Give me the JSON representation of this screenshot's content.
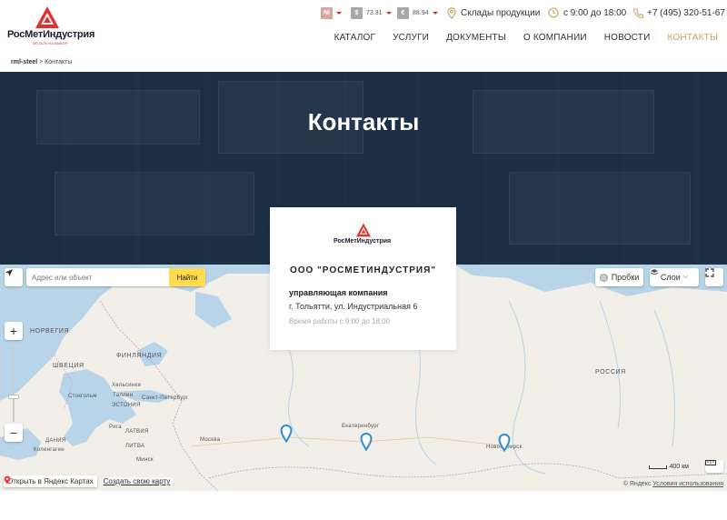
{
  "header": {
    "logo_text": "РосМетИндустрия",
    "logo_sub": "МЕТАЛЛ НА ВЫБОР",
    "currencies": [
      {
        "code": "Ni",
        "value": ""
      },
      {
        "code": "$",
        "value": "73.31"
      },
      {
        "code": "€",
        "value": "88.94"
      }
    ],
    "warehouses_label": "Склады продукции",
    "hours_label": "с 9:00 до 18:00",
    "phone": "+7 (495) 320-51-67",
    "nav": [
      "КАТАЛОГ",
      "УСЛУГИ",
      "ДОКУМЕНТЫ",
      "О КОМПАНИИ",
      "НОВОСТИ",
      "КОНТАКТЫ"
    ],
    "active_nav": "КОНТАКТЫ"
  },
  "breadcrumb": {
    "home": "rml-steel",
    "separator": " > ",
    "current": "Контакты"
  },
  "hero": {
    "title": "Контакты"
  },
  "card": {
    "logo_text": "РосМетИндустрия",
    "company": "ООО \"РОСМЕТИНДУСТРИЯ\"",
    "role": "управляющая компания",
    "address": "г. Тольятти, ул. Индустриальная 6",
    "hours": "Время работы с 9:00 до 18:00"
  },
  "map": {
    "search_placeholder": "Адрес или объект",
    "search_button": "Найти",
    "traffic_label": "Пробки",
    "layers_label": "Слои",
    "labels": {
      "norway": "НОРВЕГИЯ",
      "finland": "ФИНЛЯНДИЯ",
      "sweden": "ШВЕЦИЯ",
      "helsinki": "Хельсинки",
      "stockholm": "Стокгольм",
      "tallinn": "Таллин",
      "spb": "Санкт-Петербург",
      "estonia": "ЭСТОНИЯ",
      "latvia": "ЛАТВИЯ",
      "riga": "Рига",
      "copenhagen": "Копенгаген",
      "denmark": "ДАНИЯ",
      "lithuania": "ЛИТВА",
      "minsk": "Минск",
      "moscow": "Москва",
      "yekaterinburg": "Екатеринбург",
      "novosibirsk": "Новосибирск",
      "russia": "РОССИЯ"
    },
    "scale_label": "400 км",
    "open_in_yandex": "Открыть в Яндекс Картах",
    "create_map": "Создать свою карту",
    "copyright": "© Яндекс",
    "terms": "Условия использования",
    "colors": {
      "water": "#b7d4e8",
      "land": "#f2efe8",
      "border": "#c89ac8",
      "pin": "#2e8fd8"
    }
  }
}
